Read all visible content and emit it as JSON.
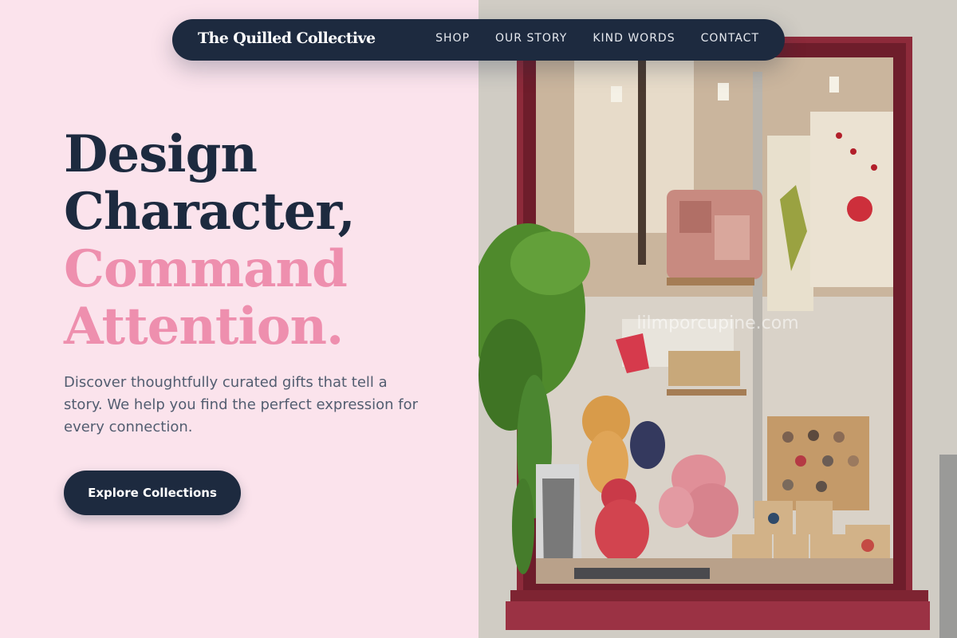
{
  "brand": {
    "name": "The Quilled Collective"
  },
  "nav": {
    "links": [
      {
        "label": "SHOP"
      },
      {
        "label": "OUR STORY"
      },
      {
        "label": "KIND WORDS"
      },
      {
        "label": "CONTACT"
      }
    ]
  },
  "hero": {
    "headline": {
      "line1": "Design",
      "line2": "Character,",
      "line3": "Command",
      "line4": "Attention."
    },
    "description": "Discover thoughtfully curated gifts that tell a story. We help you find the perfect expression for every connection.",
    "cta_label": "Explore Collections"
  },
  "photo": {
    "watermark": "lilmporcupine.com"
  },
  "colors": {
    "background": "#fbe3ec",
    "navy": "#1d2a3f",
    "pink_accent": "#ee8fae",
    "body_text": "#525d70",
    "window_frame": "#8d2a3a",
    "wall": "#cfcac3"
  }
}
